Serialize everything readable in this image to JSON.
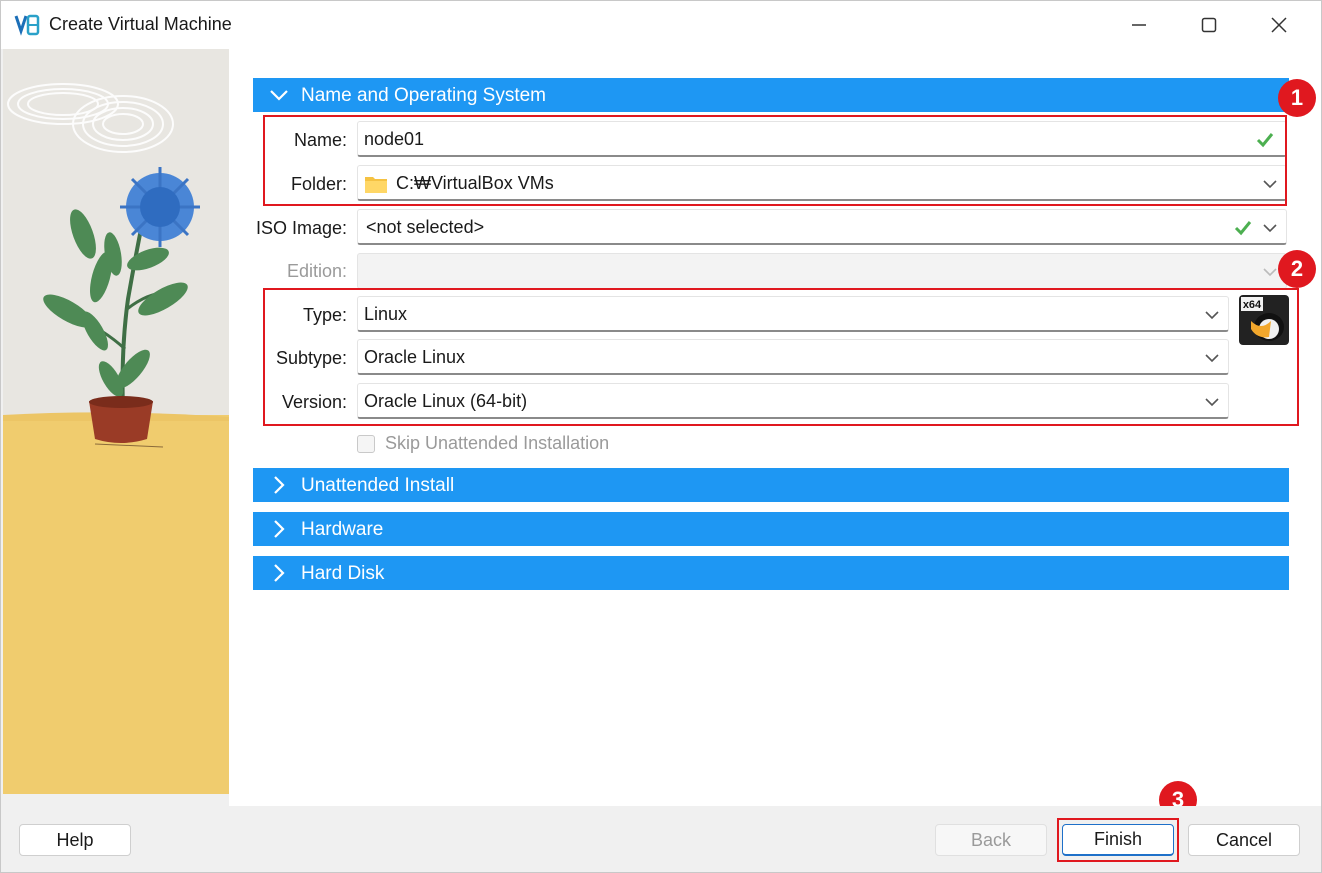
{
  "window": {
    "title": "Create Virtual Machine"
  },
  "sections": {
    "name_os": "Name and Operating System",
    "unattended": "Unattended Install",
    "hardware": "Hardware",
    "hard_disk": "Hard Disk"
  },
  "form": {
    "name_label": "Name:",
    "name_value": "node01",
    "folder_label": "Folder:",
    "folder_value": "C:₩VirtualBox VMs",
    "iso_label": "ISO Image:",
    "iso_value": "<not selected>",
    "edition_label": "Edition:",
    "edition_value": "",
    "type_label": "Type:",
    "type_value": "Linux",
    "subtype_label": "Subtype:",
    "subtype_value": "Oracle Linux",
    "version_label": "Version:",
    "version_value": "Oracle Linux (64-bit)",
    "skip_label": "Skip Unattended Installation"
  },
  "os_icon_text": "x64",
  "badges": [
    "1",
    "2",
    "3"
  ],
  "buttons": {
    "help": "Help",
    "back": "Back",
    "finish": "Finish",
    "cancel": "Cancel"
  },
  "colors": {
    "section_header": "#1e97f3",
    "annotation_red": "#e0181f",
    "check_green": "#4caf50"
  }
}
